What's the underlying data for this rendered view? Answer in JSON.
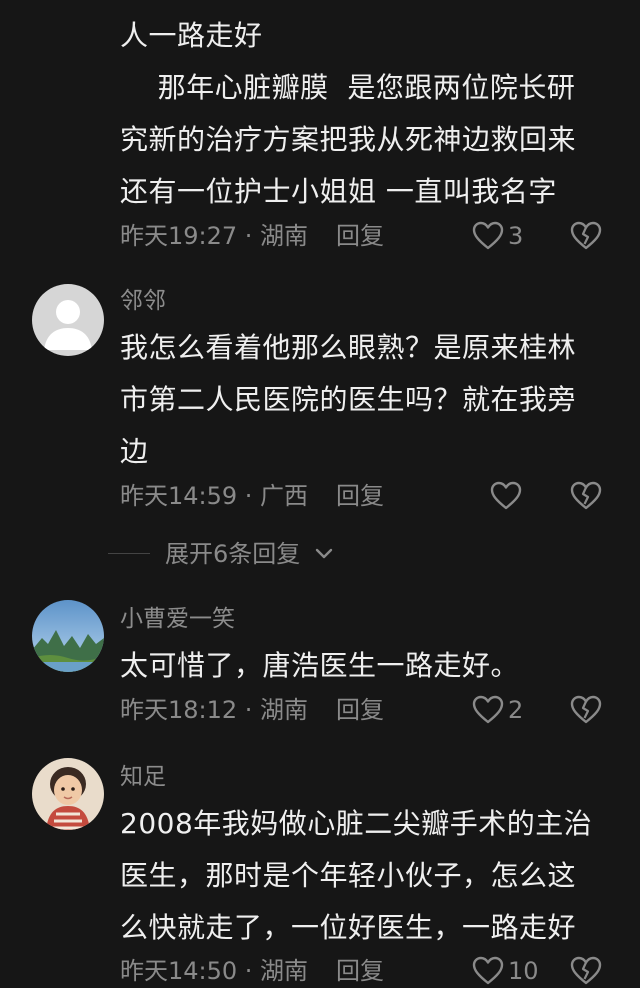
{
  "comments": [
    {
      "lines": [
        "人一路走好",
        "    那年心脏瓣膜  是您跟两位院长研",
        "究新的治疗方案把我从死神边救回来",
        "还有一位护士小姐姐 一直叫我名字"
      ],
      "meta": "昨天19:27 · 湖南",
      "reply": "回复",
      "likes": "3"
    },
    {
      "username": "邻邻",
      "avatar": "default-avatar-icon",
      "lines": [
        "我怎么看着他那么眼熟？是原来桂林",
        "市第二人民医院的医生吗？就在我旁",
        "边"
      ],
      "meta": "昨天14:59 · 广西",
      "reply": "回复",
      "likes": ""
    },
    {
      "username": "小曹爱一笑",
      "avatar": "landscape-avatar",
      "lines": [
        "太可惜了，唐浩医生一路走好。"
      ],
      "meta": "昨天18:12 · 湖南",
      "reply": "回复",
      "likes": "2"
    },
    {
      "username": "知足",
      "avatar": "child-photo-avatar",
      "lines": [
        "2008年我妈做心脏二尖瓣手术的主治",
        "医生，那时是个年轻小伙子，怎么这",
        "么快就走了，一位好医生，一路走好"
      ],
      "meta": "昨天14:50 · 湖南",
      "reply": "回复",
      "likes": "10"
    }
  ],
  "expand_replies": "展开6条回复",
  "colors": {
    "background": "#161616",
    "text": "#efefef",
    "muted": "#8a8a8a"
  }
}
